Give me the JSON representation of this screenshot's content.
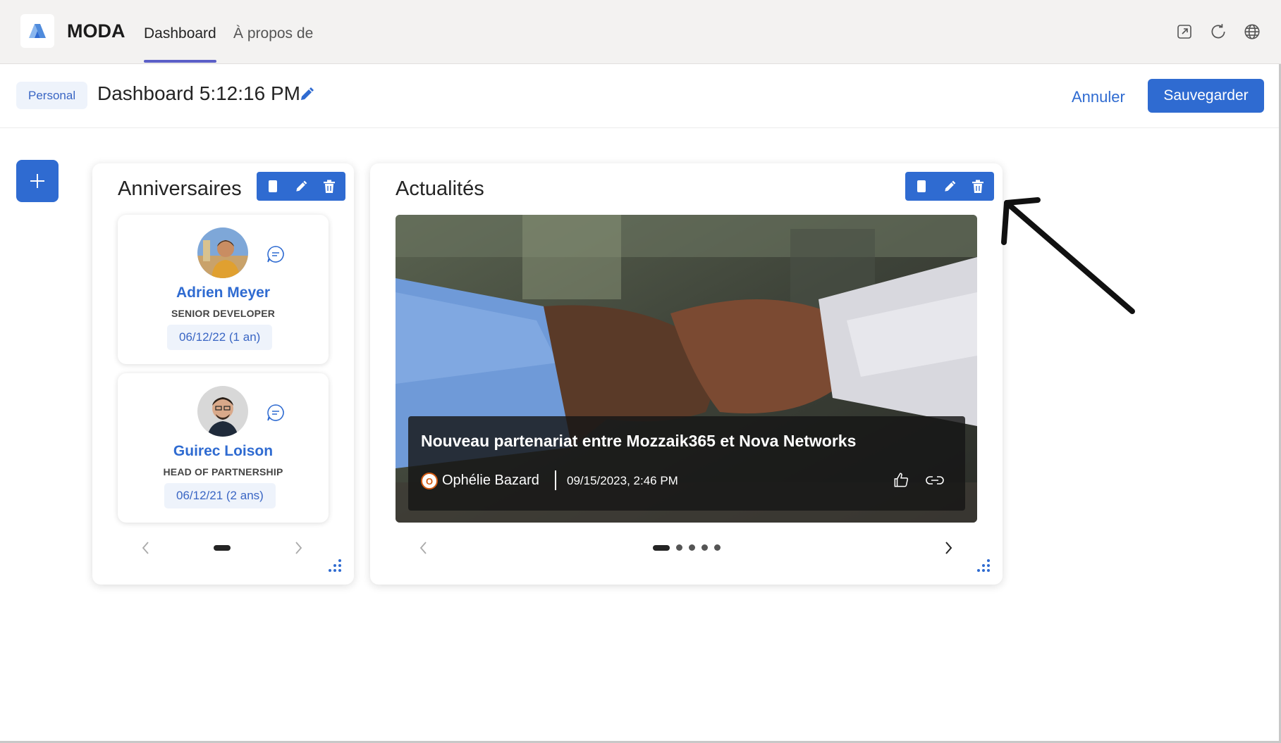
{
  "app": {
    "name": "MODA"
  },
  "nav": {
    "tabs": [
      {
        "label": "Dashboard",
        "active": true
      },
      {
        "label": "À propos de",
        "active": false
      }
    ]
  },
  "top_icons": [
    "popout-icon",
    "refresh-icon",
    "globe-icon"
  ],
  "subbar": {
    "badge": "Personal",
    "title": "Dashboard 5:12:16 PM",
    "cancel_label": "Annuler",
    "save_label": "Sauvegarder"
  },
  "anniversaires": {
    "title": "Anniversaires",
    "people": [
      {
        "name": "Adrien Meyer",
        "role": "SENIOR DEVELOPER",
        "date": "06/12/22 (1 an)"
      },
      {
        "name": "Guirec Loison",
        "role": "HEAD OF PARTNERSHIP",
        "date": "06/12/21 (2 ans)"
      }
    ],
    "page": 1,
    "page_count": 1
  },
  "actualites": {
    "title": "Actualités",
    "headline": "Nouveau partenariat entre Mozzaik365 et Nova Networks",
    "author_initial": "O",
    "author": "Ophélie Bazard",
    "date": "09/15/2023, 2:46 PM",
    "page": 1,
    "page_count": 5
  },
  "colors": {
    "accent": "#2f6bd1",
    "tab_underline": "#5b5fc7",
    "badge_bg": "#eef3fb",
    "author_ring": "#d35b12"
  }
}
